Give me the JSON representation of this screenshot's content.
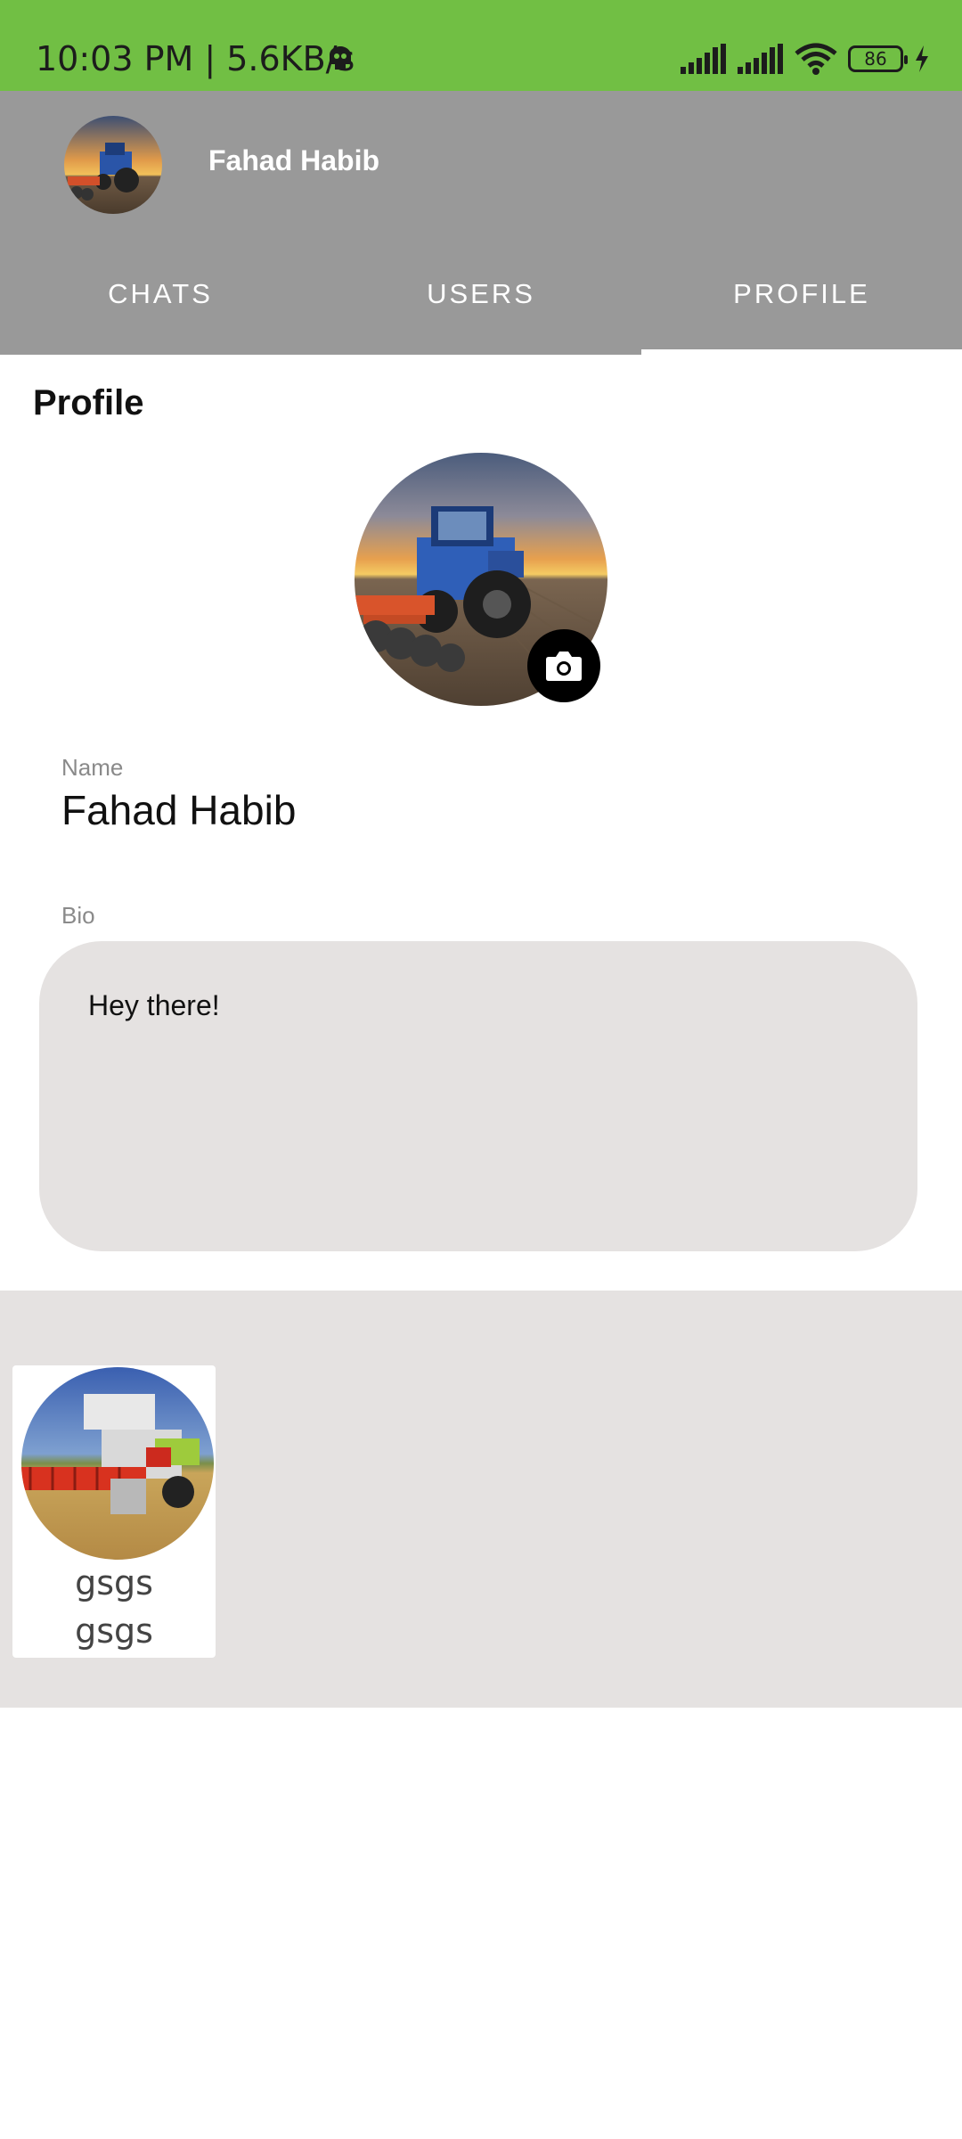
{
  "status_bar": {
    "time": "10:03 PM | 5.6KB/s",
    "battery": "86",
    "icons": [
      "notification-app-icon",
      "signal-icon",
      "signal-icon",
      "wifi-icon",
      "battery-icon",
      "charging-icon"
    ]
  },
  "header": {
    "user_name": "Fahad Habib",
    "avatar_icon": "tractor-photo"
  },
  "tabs": [
    {
      "label": "CHATS",
      "selected": false
    },
    {
      "label": "USERS",
      "selected": false
    },
    {
      "label": "PROFILE",
      "selected": true
    }
  ],
  "profile": {
    "title": "Profile",
    "photo_icon": "tractor-photo",
    "camera_icon": "camera-icon",
    "name_label": "Name",
    "name_value": "Fahad Habib",
    "bio_label": "Bio",
    "bio_value": "Hey there!"
  },
  "users_panel": {
    "items": [
      {
        "name_line1": "gsgs",
        "name_line2": "gsgs",
        "photo_icon": "harvester-photo"
      }
    ]
  },
  "colors": {
    "status_bar": "#71bf44",
    "header": "#999999",
    "bio_background": "#e5e2e1",
    "panel_background": "#e5e2e1"
  }
}
